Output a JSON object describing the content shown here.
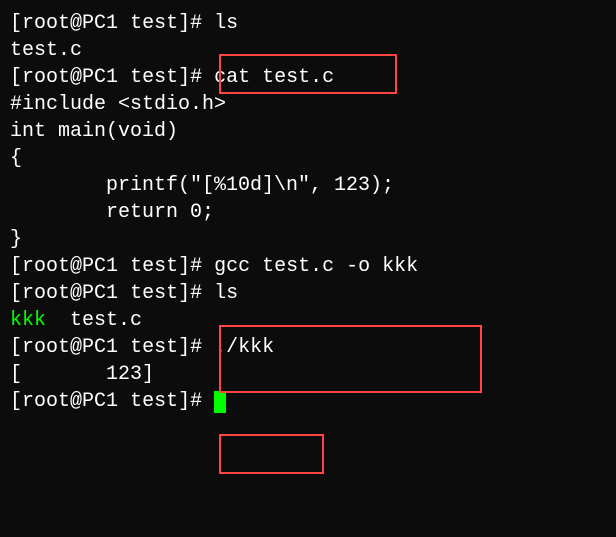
{
  "prompt": {
    "open": "[",
    "user": "root",
    "at": "@",
    "host": "PC1",
    "dir": "test",
    "close": "]#"
  },
  "lines": {
    "cmd1": "ls",
    "out1": "test.c",
    "cmd2": "cat test.c",
    "src1": "#include <stdio.h>",
    "src2": "",
    "src3": "int main(void)",
    "src4": "{",
    "src5": "        printf(\"[%10d]\\n\", 123);",
    "src6": "",
    "src7": "        return 0;",
    "src8": "}",
    "cmd3": "gcc test.c -o kkk",
    "cmd4": "ls",
    "out2a": "kkk",
    "out2b": "  test.c",
    "cmd5": "./kkk",
    "out3": "[       123]"
  }
}
